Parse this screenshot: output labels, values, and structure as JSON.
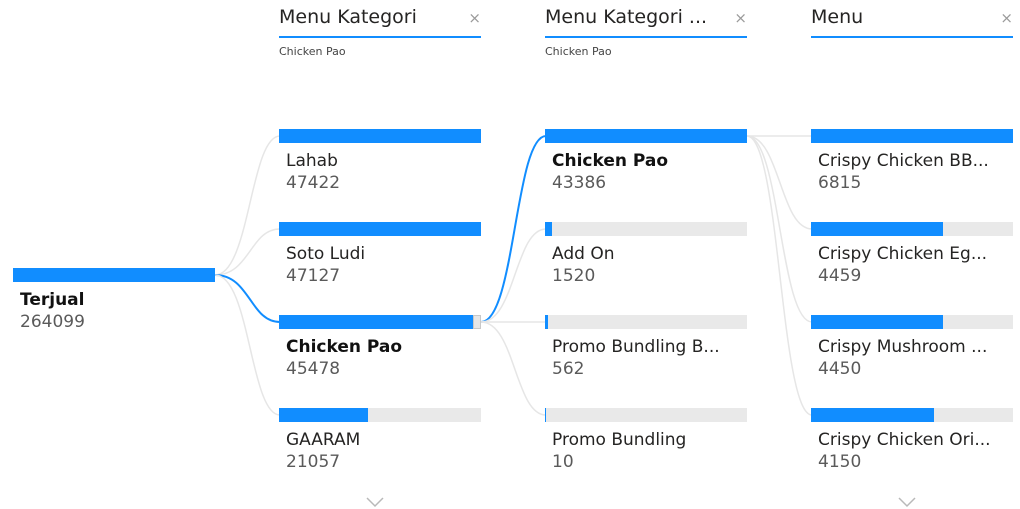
{
  "root": {
    "label": "Terjual",
    "value": "264099",
    "fill": 1.0
  },
  "columns": [
    {
      "title": "Menu Kategori",
      "subtitle": "Chicken Pao",
      "close": "×",
      "nodes": [
        {
          "label": "Lahab",
          "value": "47422",
          "fill": 1.0
        },
        {
          "label": "Soto Ludi",
          "value": "47127",
          "fill": 1.0
        },
        {
          "label": "Chicken Pao",
          "value": "45478",
          "fill": 0.96,
          "selected": true
        },
        {
          "label": "GAARAM",
          "value": "21057",
          "fill": 0.44
        }
      ]
    },
    {
      "title": "Menu Kategori ...",
      "subtitle": "Chicken Pao",
      "close": "×",
      "nodes": [
        {
          "label": "Chicken Pao",
          "value": "43386",
          "fill": 1.0,
          "selected": true
        },
        {
          "label": "Add On",
          "value": "1520",
          "fill": 0.035
        },
        {
          "label": "Promo Bundling B...",
          "value": "562",
          "fill": 0.013
        },
        {
          "label": "Promo Bundling",
          "value": "10",
          "fill": 0.0002
        }
      ]
    },
    {
      "title": "Menu",
      "subtitle": "",
      "close": "×",
      "nodes": [
        {
          "label": "Crispy Chicken BB...",
          "value": "6815",
          "fill": 1.0
        },
        {
          "label": "Crispy Chicken Eg...",
          "value": "4459",
          "fill": 0.654
        },
        {
          "label": "Crispy Mushroom ...",
          "value": "4450",
          "fill": 0.653
        },
        {
          "label": "Crispy Chicken Ori...",
          "value": "4150",
          "fill": 0.609
        }
      ]
    }
  ],
  "colors": {
    "accent": "#118dff",
    "track": "#e9e9e9",
    "connector": "#e3e3e3"
  },
  "icons": {
    "close": "close-icon",
    "more": "chevron-down-icon"
  }
}
